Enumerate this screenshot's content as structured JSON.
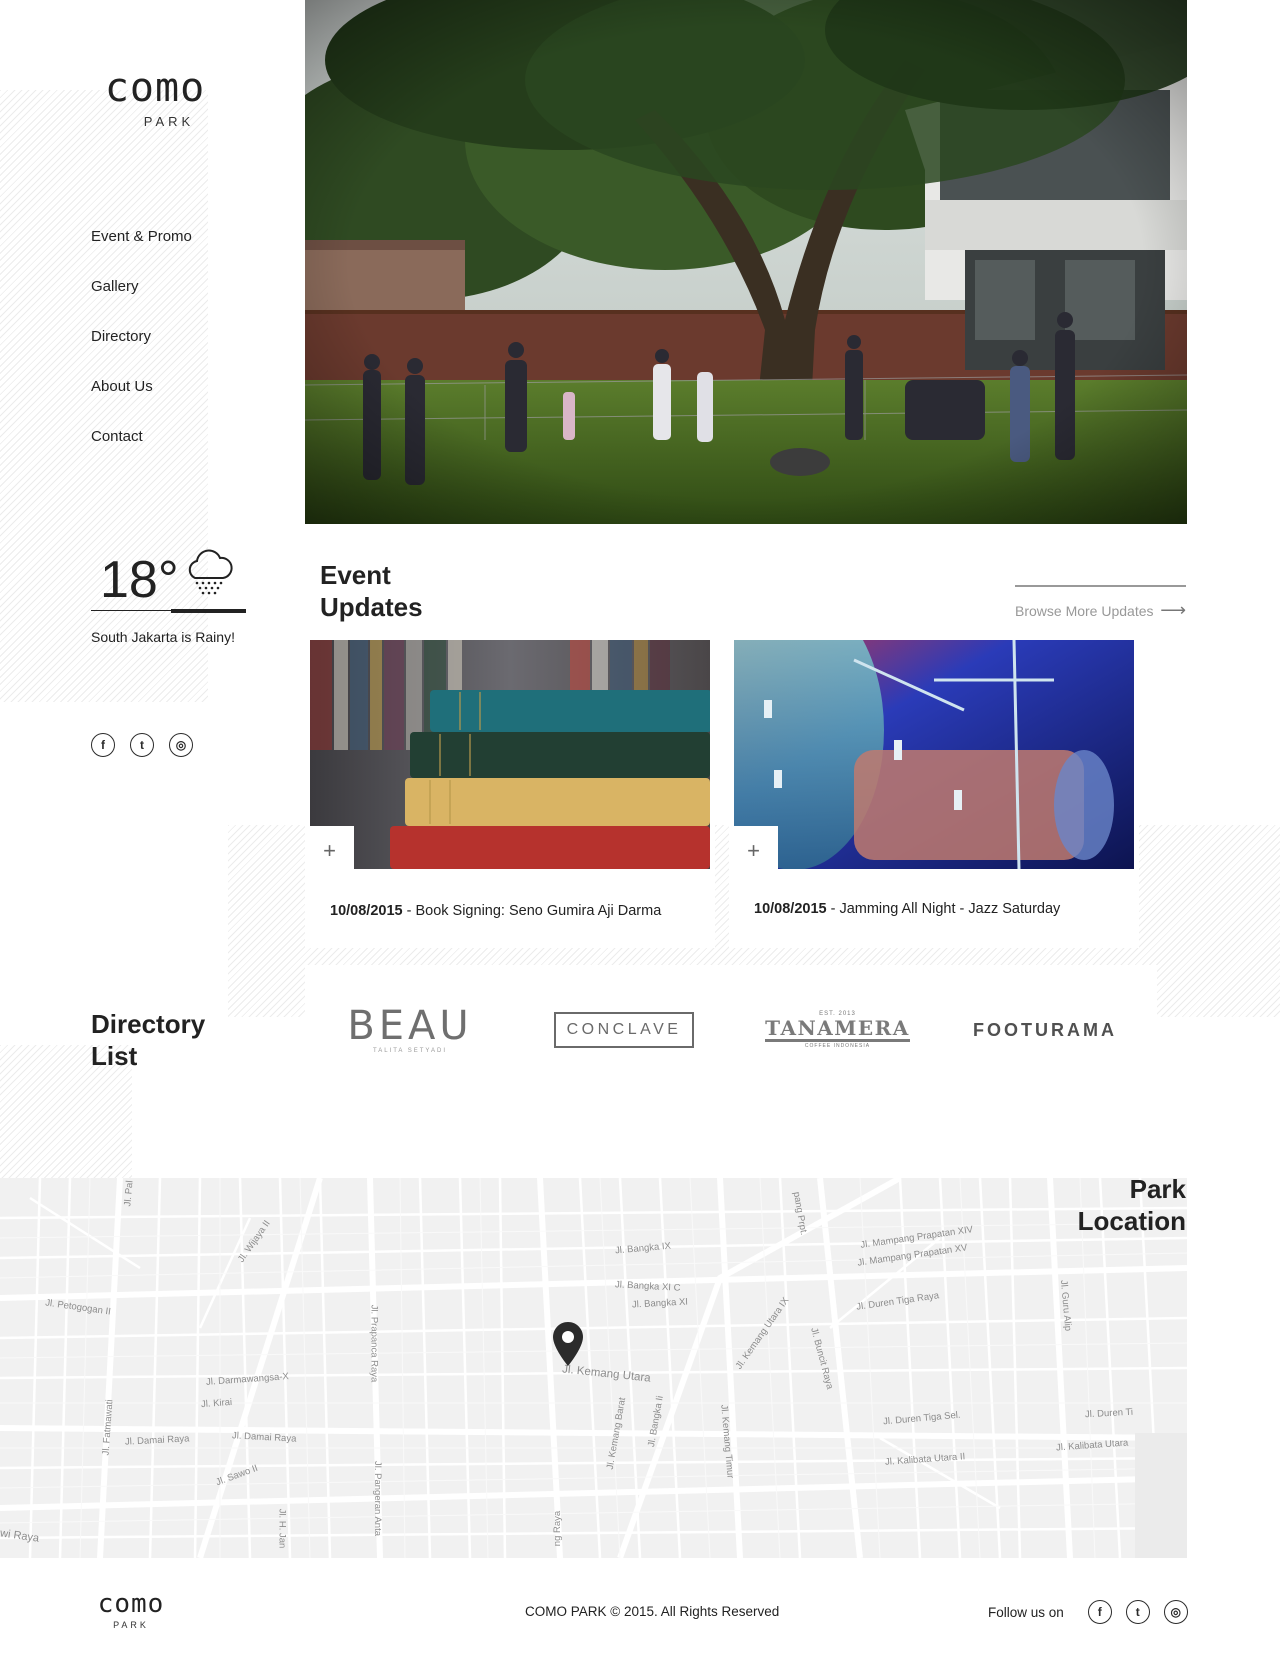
{
  "brand": {
    "logo_word": "como",
    "logo_sub": "PARK"
  },
  "nav": [
    {
      "label": "Event & Promo"
    },
    {
      "label": "Gallery"
    },
    {
      "label": "Directory"
    },
    {
      "label": "About Us"
    },
    {
      "label": "Contact"
    }
  ],
  "weather": {
    "temperature": "18°",
    "condition_text": "South Jakarta is Rainy!",
    "icon": "rain-cloud-icon"
  },
  "social": [
    {
      "icon": "facebook-icon",
      "glyph": "f"
    },
    {
      "icon": "twitter-icon",
      "glyph": "t"
    },
    {
      "icon": "instagram-icon",
      "glyph": "◎"
    }
  ],
  "events": {
    "title_line1": "Event",
    "title_line2": "Updates",
    "browse_label": "Browse More Updates",
    "cards": [
      {
        "date": "10/08/2015",
        "title": " - Book Signing: Seno Gumira Aji Darma",
        "plus": "+"
      },
      {
        "date": "10/08/2015",
        "title": " - Jamming All Night - Jazz Saturday",
        "plus": "+"
      }
    ]
  },
  "directory": {
    "title_line1": "Directory",
    "title_line2": "List",
    "brands": [
      {
        "name": "BEAU",
        "sub": "TALITA SETYADI"
      },
      {
        "name": "CONCLAVE"
      },
      {
        "name": "TANAMERA",
        "top": "EST. 2013",
        "sub": "COFFEE INDONESIA"
      },
      {
        "name": "FOOTURAMA"
      }
    ]
  },
  "location": {
    "title_line1": "Park",
    "title_line2": "Location",
    "map_labels": [
      "Jl. Petogogan II",
      "Jl. Wijaya II",
      "Jl. Pal",
      "Jl. Bangka IX",
      "Jl. Bangka XI C",
      "Jl. Bangka XI",
      "Jl. Mampang Prapatan XIV",
      "Jl. Mampang Prapatan XV",
      "Jl. Duren Tiga Raya",
      "Jl. Guru Alip",
      "Jl. Prapanca Raya",
      "Jl. Darmawangsa-X",
      "Jl. Kirai",
      "Jl. Damai Raya",
      "Jl. Damai Raya",
      "Jl. Fatmawati",
      "Jl. Sawo II",
      "Jl. Kemang Utara",
      "Jl. Kemang Barat",
      "Jl. Bangka Ii",
      "Jl. Kemang Timur",
      "Jl. Kemang Utara IX",
      "Jl. Buncit Raya",
      "Jl. Duren Tiga Sel.",
      "Jl. Duren Ti",
      "Jl. Kalibata Utara II",
      "Jl. Kalibata Utara",
      "Jl. Pangeran Anta",
      "Jl. H. Jan",
      "wi Raya",
      "ng Raya",
      "pang Prpt."
    ]
  },
  "footer": {
    "copyright": "COMO PARK © 2015. All Rights Reserved",
    "follow_label": "Follow us on"
  }
}
